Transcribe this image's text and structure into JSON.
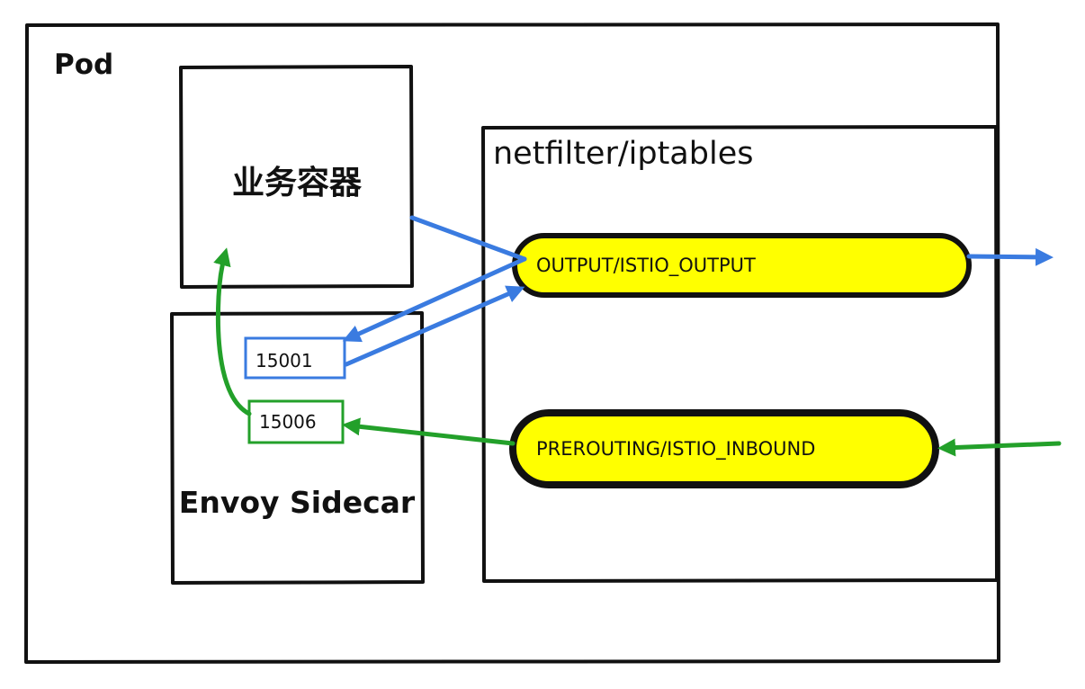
{
  "labels": {
    "pod": "Pod",
    "business_container": "业务容器",
    "netfilter": "netfilter/iptables",
    "envoy_sidecar": "Envoy Sidecar",
    "port_outbound": "15001",
    "port_inbound": "15006",
    "chain_output": "OUTPUT/ISTIO_OUTPUT",
    "chain_inbound": "PREROUTING/ISTIO_INBOUND"
  },
  "colors": {
    "outline": "#111111",
    "outbound_flow": "#3a7be0",
    "inbound_flow": "#23a02a",
    "chain_fill": "#ffff00"
  }
}
